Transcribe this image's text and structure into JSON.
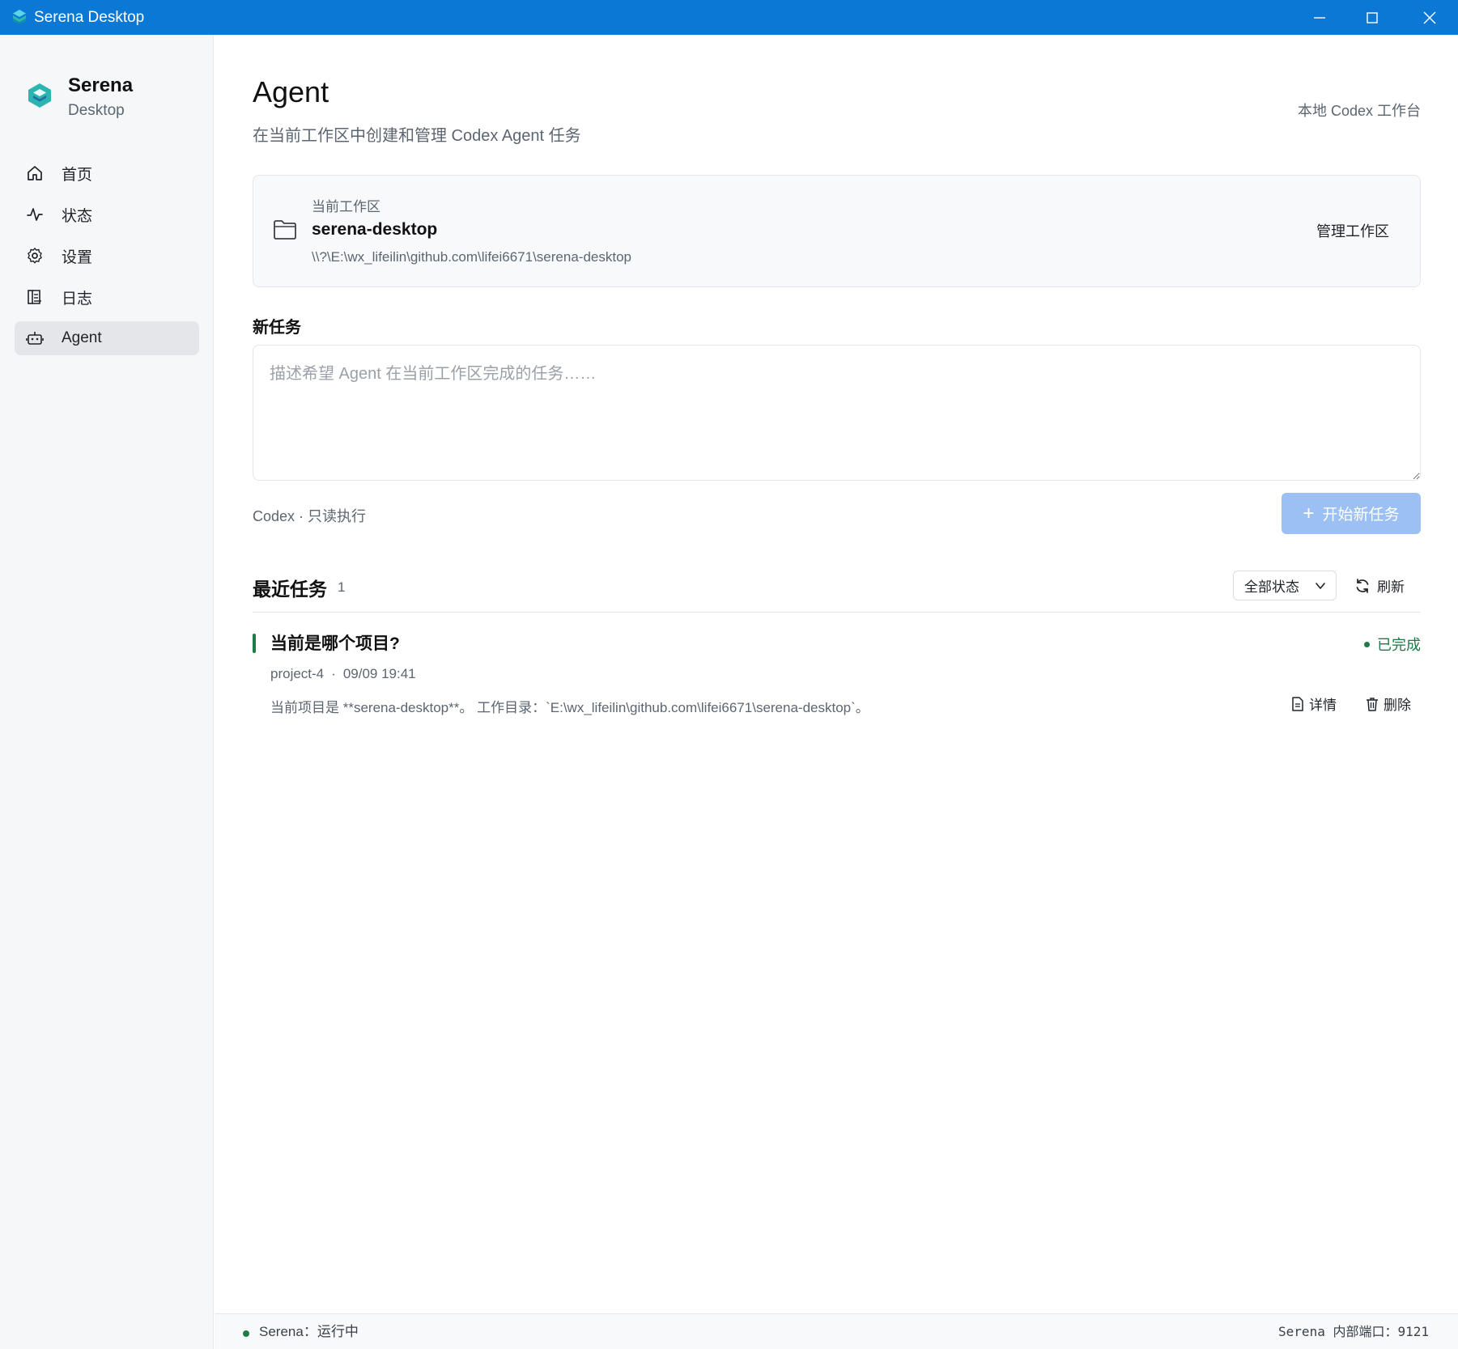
{
  "window": {
    "title": "Serena Desktop",
    "accent_color": "#0a78d4",
    "controls": [
      "minimize-icon",
      "maximize-icon",
      "close-icon"
    ]
  },
  "sidebar": {
    "brand": {
      "name": "Serena",
      "sub": "Desktop",
      "logo": "serena-logo-icon"
    },
    "items": [
      {
        "label": "首页",
        "icon": "home-icon",
        "active": false
      },
      {
        "label": "状态",
        "icon": "activity-icon",
        "active": false
      },
      {
        "label": "设置",
        "icon": "gear-icon",
        "active": false
      },
      {
        "label": "日志",
        "icon": "log-icon",
        "active": false
      },
      {
        "label": "Agent",
        "icon": "robot-icon",
        "active": true
      }
    ]
  },
  "header": {
    "title": "Agent",
    "subtitle": "在当前工作区中创建和管理 Codex Agent 任务",
    "tag": "本地 Codex 工作台"
  },
  "workspace": {
    "label": "当前工作区",
    "name": "serena-desktop",
    "path": "\\\\?\\E:\\wx_lifeilin\\github.com\\lifei6671\\serena-desktop",
    "manage_label": "管理工作区",
    "icon": "folder-icon"
  },
  "new_task": {
    "label": "新任务",
    "placeholder": "描述希望 Agent 在当前工作区完成的任务……",
    "value": "",
    "mode_text": "Codex · 只读执行",
    "start_label": "开始新任务",
    "start_enabled": false,
    "start_color": "#9cc0f4"
  },
  "recent": {
    "title": "最近任务",
    "count": "1",
    "filter_value": "全部状态",
    "refresh_label": "刷新",
    "tasks": [
      {
        "title": "当前是哪个项目?",
        "status": "已完成",
        "status_color": "#1e7a46",
        "project": "project-4",
        "time": "09/09 19:41",
        "summary": "当前项目是 **serena-desktop**。 工作目录：`E:\\wx_lifeilin\\github.com\\lifei6671\\serena-desktop`。",
        "detail_label": "详情",
        "delete_label": "删除"
      }
    ]
  },
  "footer": {
    "status_text": "Serena：运行中",
    "port_text": "Serena 内部端口：9121",
    "status_color": "#1e7a46"
  }
}
